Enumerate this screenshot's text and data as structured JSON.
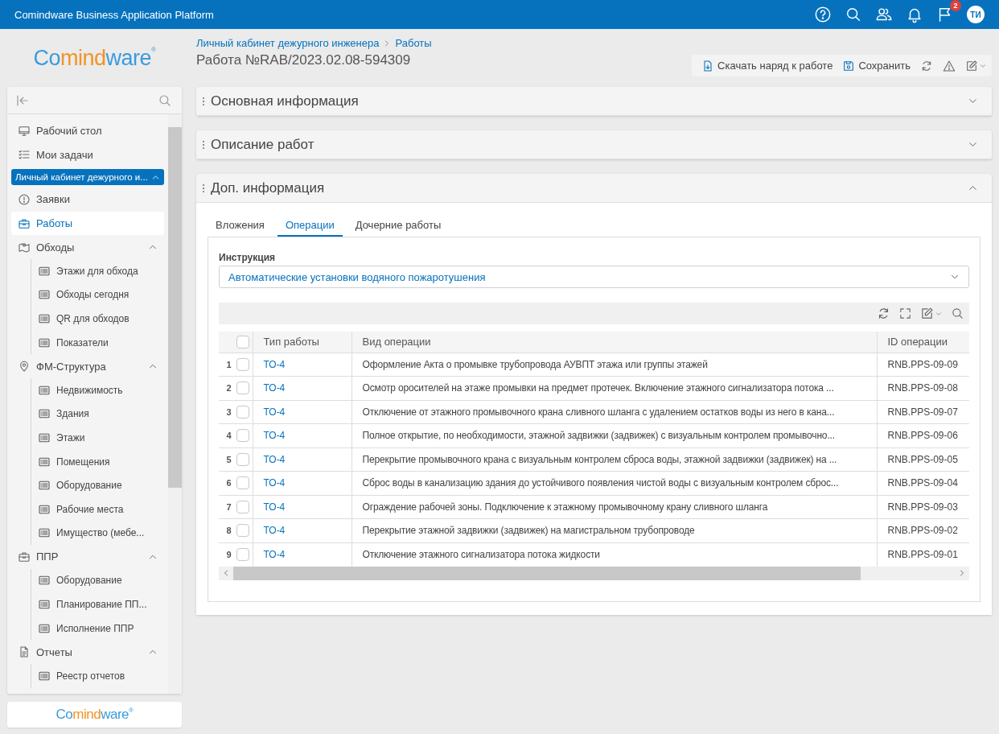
{
  "app_bar": {
    "title": "Comindware Business Application Platform",
    "notifications_badge": "2",
    "avatar_initials": "ТИ"
  },
  "logos": [
    {
      "text_1": "Co",
      "text_2": "mind",
      "text_3": "ware",
      "mark": "®"
    },
    {
      "text_1": "Co",
      "text_2": "mind",
      "text_3": "ware",
      "mark": "®"
    }
  ],
  "breadcrumb": [
    "Личный кабинет дежурного инженера",
    "Работы"
  ],
  "page_title": "Работа №RAB/2023.02.08-594309",
  "toolbar": {
    "download": "Скачать наряд к работе",
    "save": "Сохранить"
  },
  "sidebar": {
    "items": [
      {
        "kind": "item",
        "label": "Рабочий стол",
        "selected": false
      },
      {
        "kind": "item",
        "label": "Мои задачи",
        "selected": false
      },
      {
        "kind": "app",
        "label": "Личный кабинет дежурного и...",
        "expanded": true
      },
      {
        "kind": "item",
        "label": "Заявки",
        "selected": false
      },
      {
        "kind": "item",
        "label": "Работы",
        "selected": true
      },
      {
        "kind": "group",
        "label": "Обходы",
        "expanded": true,
        "children": [
          "Этажи для обхода",
          "Обходы сегодня",
          "QR для обходов",
          "Показатели"
        ]
      },
      {
        "kind": "group",
        "label": "ФМ-Структура",
        "expanded": true,
        "children": [
          "Недвижимость",
          "Здания",
          "Этажи",
          "Помещения",
          "Оборудование",
          "Рабочие места",
          "Имущество (мебе..."
        ]
      },
      {
        "kind": "group",
        "label": "ППР",
        "expanded": true,
        "children": [
          "Оборудование",
          "Планирование ПП...",
          "Исполнение ППР"
        ]
      },
      {
        "kind": "group",
        "label": "Отчеты",
        "expanded": true,
        "children": [
          "Реестр отчетов"
        ]
      }
    ]
  },
  "sections": [
    {
      "title": "Основная информация",
      "expanded": false
    },
    {
      "title": "Описание работ",
      "expanded": false
    },
    {
      "title": "Доп. информация",
      "expanded": true
    }
  ],
  "tabs": [
    {
      "label": "Вложения",
      "selected": false
    },
    {
      "label": "Операции",
      "selected": true
    },
    {
      "label": "Дочерние работы",
      "selected": false
    }
  ],
  "instruction": {
    "label": "Инструкция",
    "value": "Автоматические установки водяного пожаротушения"
  },
  "table": {
    "header_checked": false,
    "columns": [
      "Тип работы",
      "Вид операции",
      "ID операции"
    ],
    "rows": [
      {
        "number": "1",
        "checked": false,
        "type": "ТО-4",
        "operation": "Оформление Акта о промывке трубопровода АУВПТ этажа или группы этажей",
        "id": "RNB.PPS-09-09"
      },
      {
        "number": "2",
        "checked": false,
        "type": "ТО-4",
        "operation": "Осмотр оросителей на этаже промывки на предмет протечек. Включение этажного сигнализатора потока ...",
        "id": "RNB.PPS-09-08"
      },
      {
        "number": "3",
        "checked": false,
        "type": "ТО-4",
        "operation": "Отключение от этажного промывочного крана сливного шланга с удалением остатков воды из него в кана...",
        "id": "RNB.PPS-09-07"
      },
      {
        "number": "4",
        "checked": false,
        "type": "ТО-4",
        "operation": "Полное открытие, по необходимости, этажной задвижки (задвижек) с визуальным контролем промывочно...",
        "id": "RNB.PPS-09-06"
      },
      {
        "number": "5",
        "checked": false,
        "type": "ТО-4",
        "operation": "Перекрытие промывочного крана с визуальным контролем сброса воды, этажной задвижки (задвижек) на ...",
        "id": "RNB.PPS-09-05"
      },
      {
        "number": "6",
        "checked": false,
        "type": "ТО-4",
        "operation": "Сброс воды в канализацию здания до устойчивого появления чистой воды с визуальным контролем сброс...",
        "id": "RNB.PPS-09-04"
      },
      {
        "number": "7",
        "checked": false,
        "type": "ТО-4",
        "operation": "Ограждение рабочей зоны. Подключение к этажному промывочному крану сливного шланга",
        "id": "RNB.PPS-09-03"
      },
      {
        "number": "8",
        "checked": false,
        "type": "ТО-4",
        "operation": "Перекрытие этажной задвижки (задвижек) на магистральном трубопроводе",
        "id": "RNB.PPS-09-02"
      },
      {
        "number": "9",
        "checked": false,
        "type": "ТО-4",
        "operation": "Отключение этажного сигнализатора потока жидкости",
        "id": "RNB.PPS-09-01"
      }
    ]
  }
}
